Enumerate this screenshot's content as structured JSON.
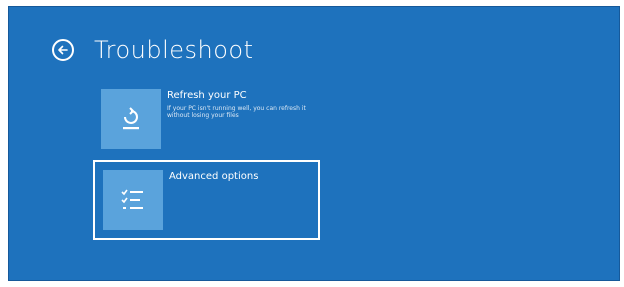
{
  "page": {
    "title": "Troubleshoot"
  },
  "options": [
    {
      "label": "Refresh your PC",
      "description": "If your PC isn't running well, you can refresh it without losing your files",
      "icon": "refresh-icon"
    },
    {
      "label": "Advanced options",
      "description": "",
      "icon": "checklist-icon"
    }
  ],
  "colors": {
    "background": "#1e72bd",
    "tile": "#5aa3dc",
    "text": "#ffffff"
  }
}
